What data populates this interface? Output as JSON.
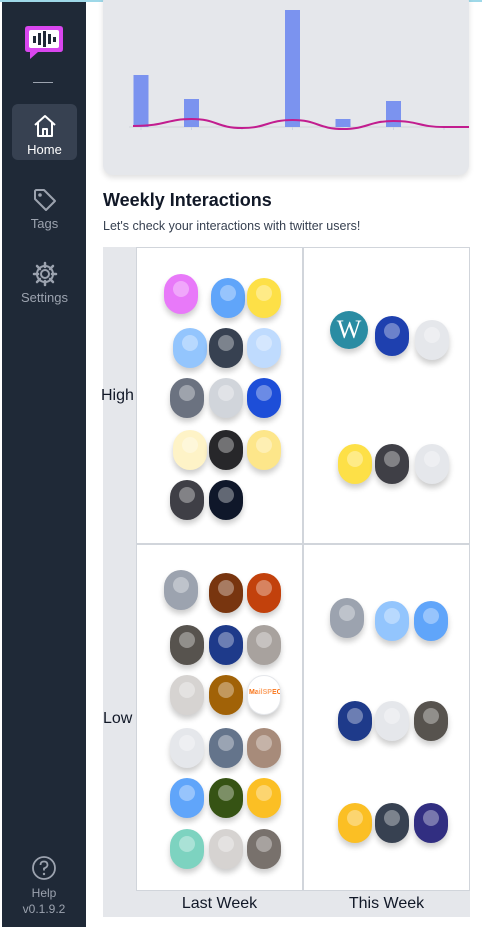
{
  "sidebar": {
    "items": [
      {
        "label": "Home",
        "icon": "home-icon",
        "active": true
      },
      {
        "label": "Tags",
        "icon": "tag-icon",
        "active": false
      },
      {
        "label": "Settings",
        "icon": "gear-icon",
        "active": false
      }
    ],
    "help_label": "Help",
    "version": "v0.1.9.2"
  },
  "chart_data": {
    "type": "bar",
    "categories": [
      "",
      "",
      "",
      "",
      "",
      "",
      ""
    ],
    "values": [
      52,
      28,
      0,
      117,
      8,
      26,
      0
    ],
    "series": [
      {
        "type": "bar",
        "values": [
          52,
          28,
          0,
          117,
          8,
          26,
          0
        ]
      },
      {
        "type": "line",
        "values": [
          1,
          8,
          -1,
          7,
          -2,
          6,
          0
        ]
      }
    ],
    "ylim": [
      -10,
      120
    ]
  },
  "weekly": {
    "title": "Weekly Interactions",
    "subtitle": "Let's check your interactions with twitter users!",
    "row_labels": [
      "High",
      "Low"
    ],
    "col_labels": [
      "Last Week",
      "This Week"
    ],
    "wordpress_letter": "W",
    "logo_text": "MailSPEC",
    "avatar_colors": {
      "high_last": [
        "#e879f9",
        "#60a5fa",
        "#fde047",
        "#93c5fd",
        "#374151",
        "#bfdbfe",
        "#6b7280",
        "#d1d5db",
        "#1d4ed8",
        "#fef3c7",
        "#27272a",
        "#fde68a",
        "#3f3f46",
        "#0f172a"
      ],
      "high_this": [
        "#2a8ca3",
        "#1e40af",
        "#e5e7eb",
        "#fde047",
        "#3f3f46",
        "#e5e7eb"
      ],
      "low_last": [
        "#9ca3af",
        "#78350f",
        "#c2410c",
        "#57534e",
        "#1e3a8a",
        "#a8a29e",
        "#d6d3d1",
        "#a16207",
        "#e0f2fe",
        "#e5e7eb",
        "#64748b",
        "#a78b7a",
        "#60a5fa",
        "#365314",
        "#fbbf24",
        "#7dd3c0",
        "#d6d3d1",
        "#78716c"
      ],
      "low_this": [
        "#9ca3af",
        "#93c5fd",
        "#60a5fa",
        "#1e3a8a",
        "#e5e7eb",
        "#57534e",
        "#fbbf24",
        "#374151",
        "#312e81"
      ]
    }
  }
}
